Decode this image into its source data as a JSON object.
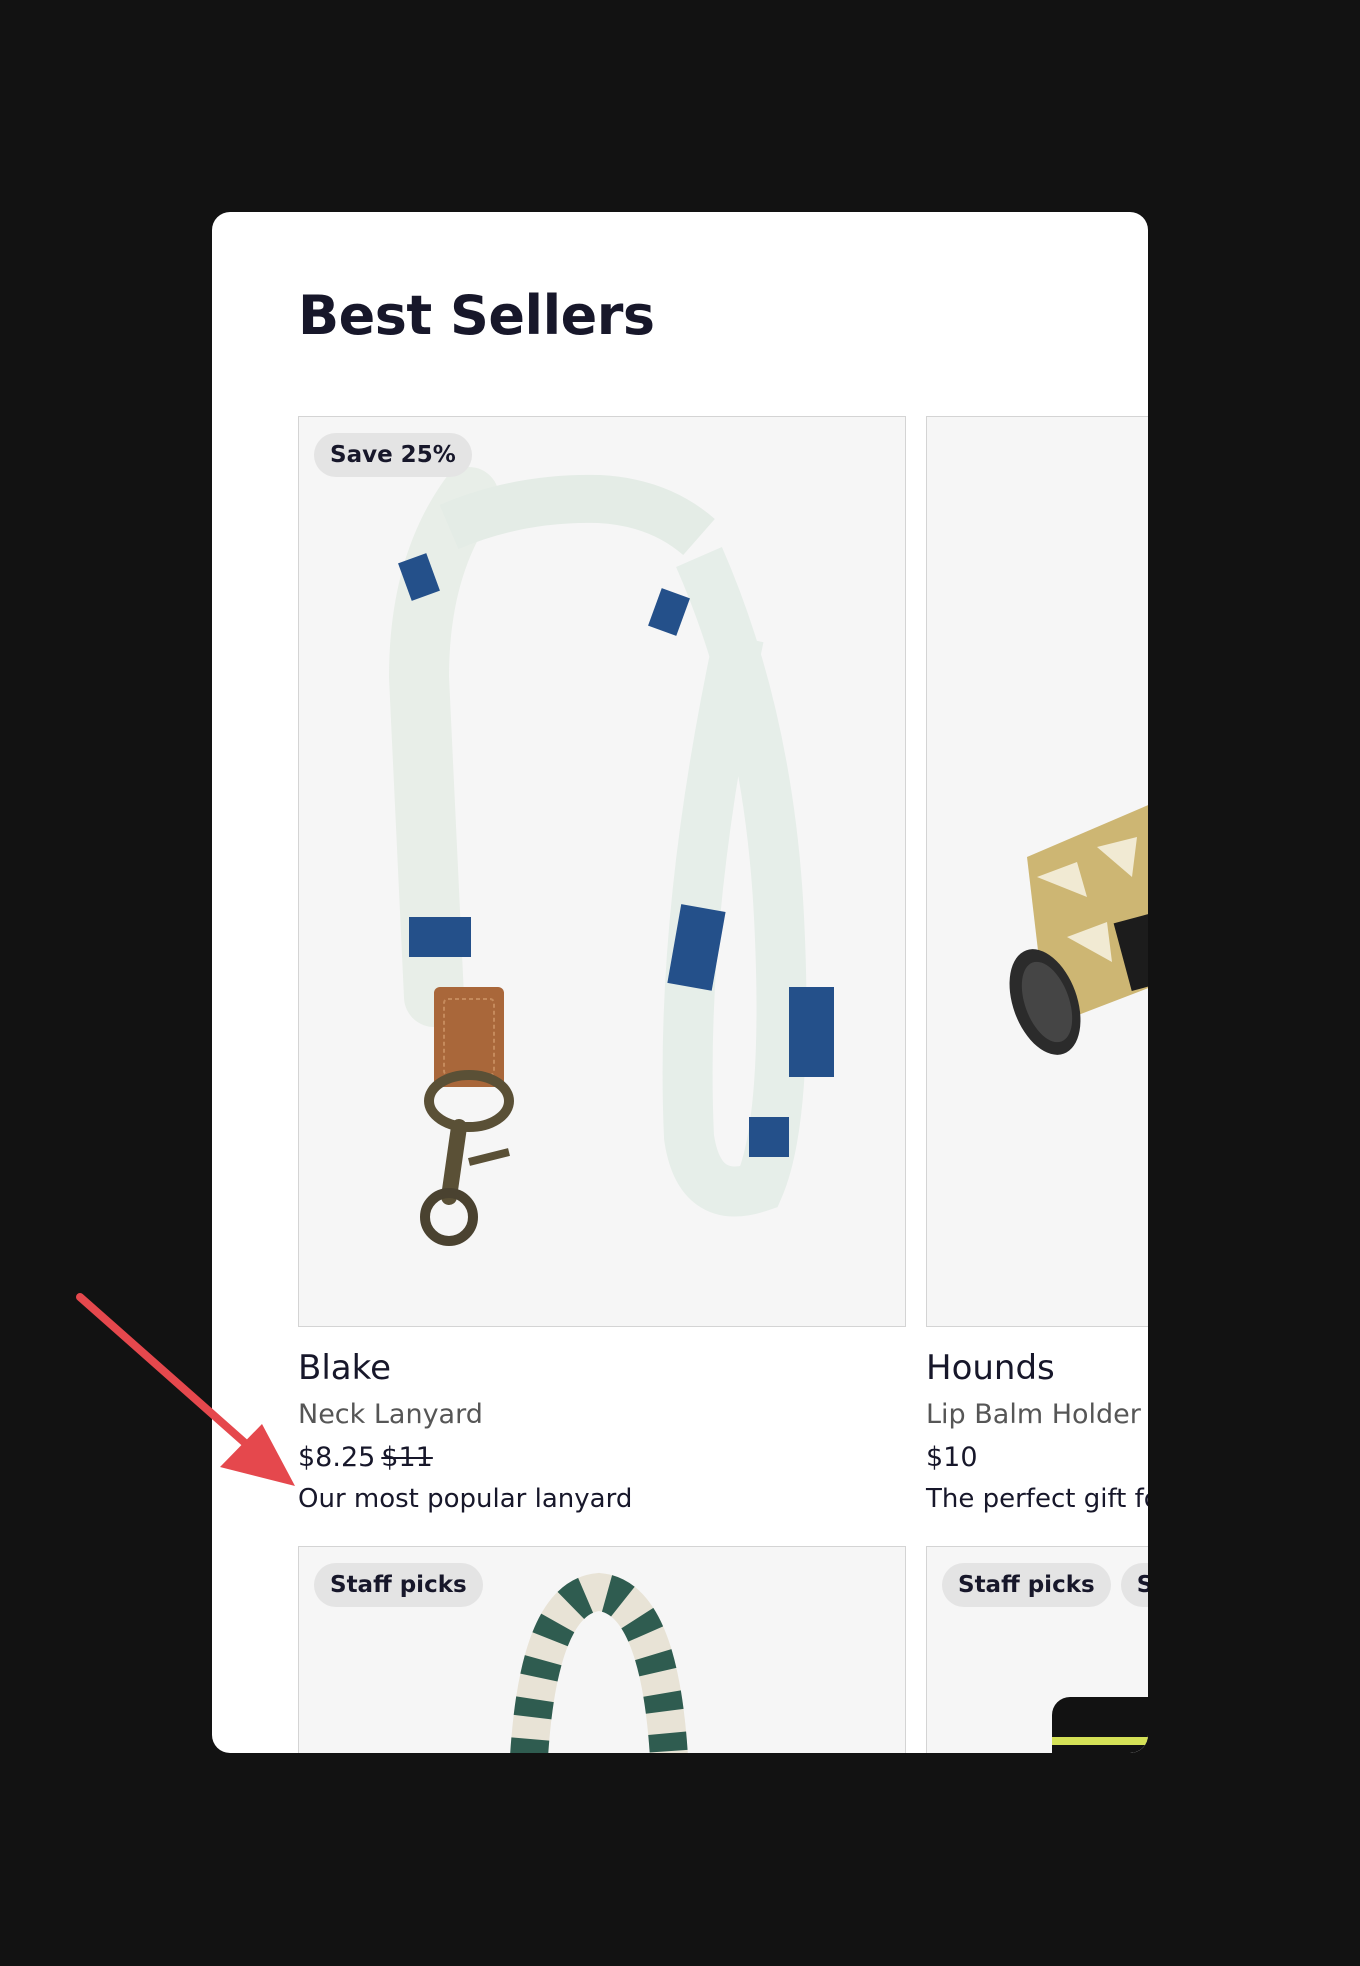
{
  "section": {
    "title": "Best Sellers"
  },
  "products": [
    {
      "name": "Blake",
      "type": "Neck Lanyard",
      "price": "$8.25",
      "original_price": "$11",
      "description": "Our most popular lanyard",
      "badges": [
        "Save 25%"
      ]
    },
    {
      "name": "Hounds",
      "type": "Lip Balm Holder",
      "price": "$10",
      "description": "The perfect gift fo",
      "badges": []
    },
    {
      "badges": [
        "Staff picks"
      ]
    },
    {
      "badges": [
        "Staff picks",
        "Sa"
      ]
    }
  ],
  "colors": {
    "background": "#121212",
    "panel": "#ffffff",
    "text": "#17172a",
    "badge": "#e4e4e4",
    "annotation_arrow": "#e5484d"
  }
}
